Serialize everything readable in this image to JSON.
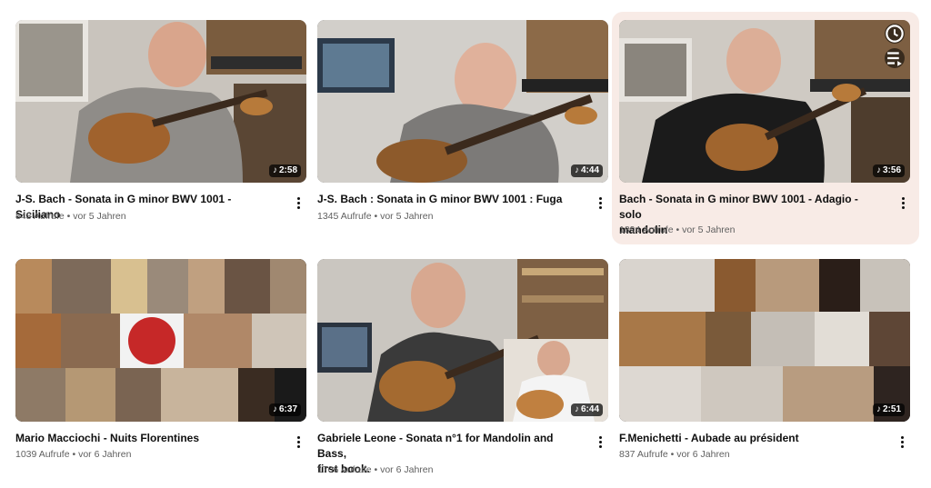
{
  "videos": [
    {
      "title": "J-S. Bach - Sonata in G minor BWV 1001 - Siciliano",
      "views": "848 Aufrufe",
      "age": "vor 5 Jahren",
      "duration": "2:58"
    },
    {
      "title": "J-S. Bach : Sonata in G minor BWV 1001 : Fuga",
      "views": "1345 Aufrufe",
      "age": "vor 5 Jahren",
      "duration": "4:44"
    },
    {
      "title_line1": "Bach - Sonata in G minor BWV 1001 - Adagio - solo",
      "title_line2": "mandolin",
      "views": "1894 Aufrufe",
      "age": "vor 5 Jahren",
      "duration": "3:56"
    },
    {
      "title": "Mario Macciochi - Nuits Florentines",
      "views": "1039 Aufrufe",
      "age": "vor 6 Jahren",
      "duration": "6:37"
    },
    {
      "title_line1": "Gabriele Leone - Sonata n°1 for Mandolin and Bass,",
      "title_line2": "first book.",
      "views": "1706 Aufrufe",
      "age": "vor 6 Jahren",
      "duration": "6:44"
    },
    {
      "title": "F.Menichetti - Aubade au président",
      "views": "837 Aufrufe",
      "age": "vor 6 Jahren",
      "duration": "2:51"
    }
  ],
  "separator": "•",
  "icons": {
    "watch_later": "clock-icon",
    "add_queue": "queue-icon",
    "more": "more-vert-icon",
    "short_note": "music-note-icon"
  },
  "colors": {
    "hover_bg": "#f8ebe6",
    "meta": "#606060"
  }
}
